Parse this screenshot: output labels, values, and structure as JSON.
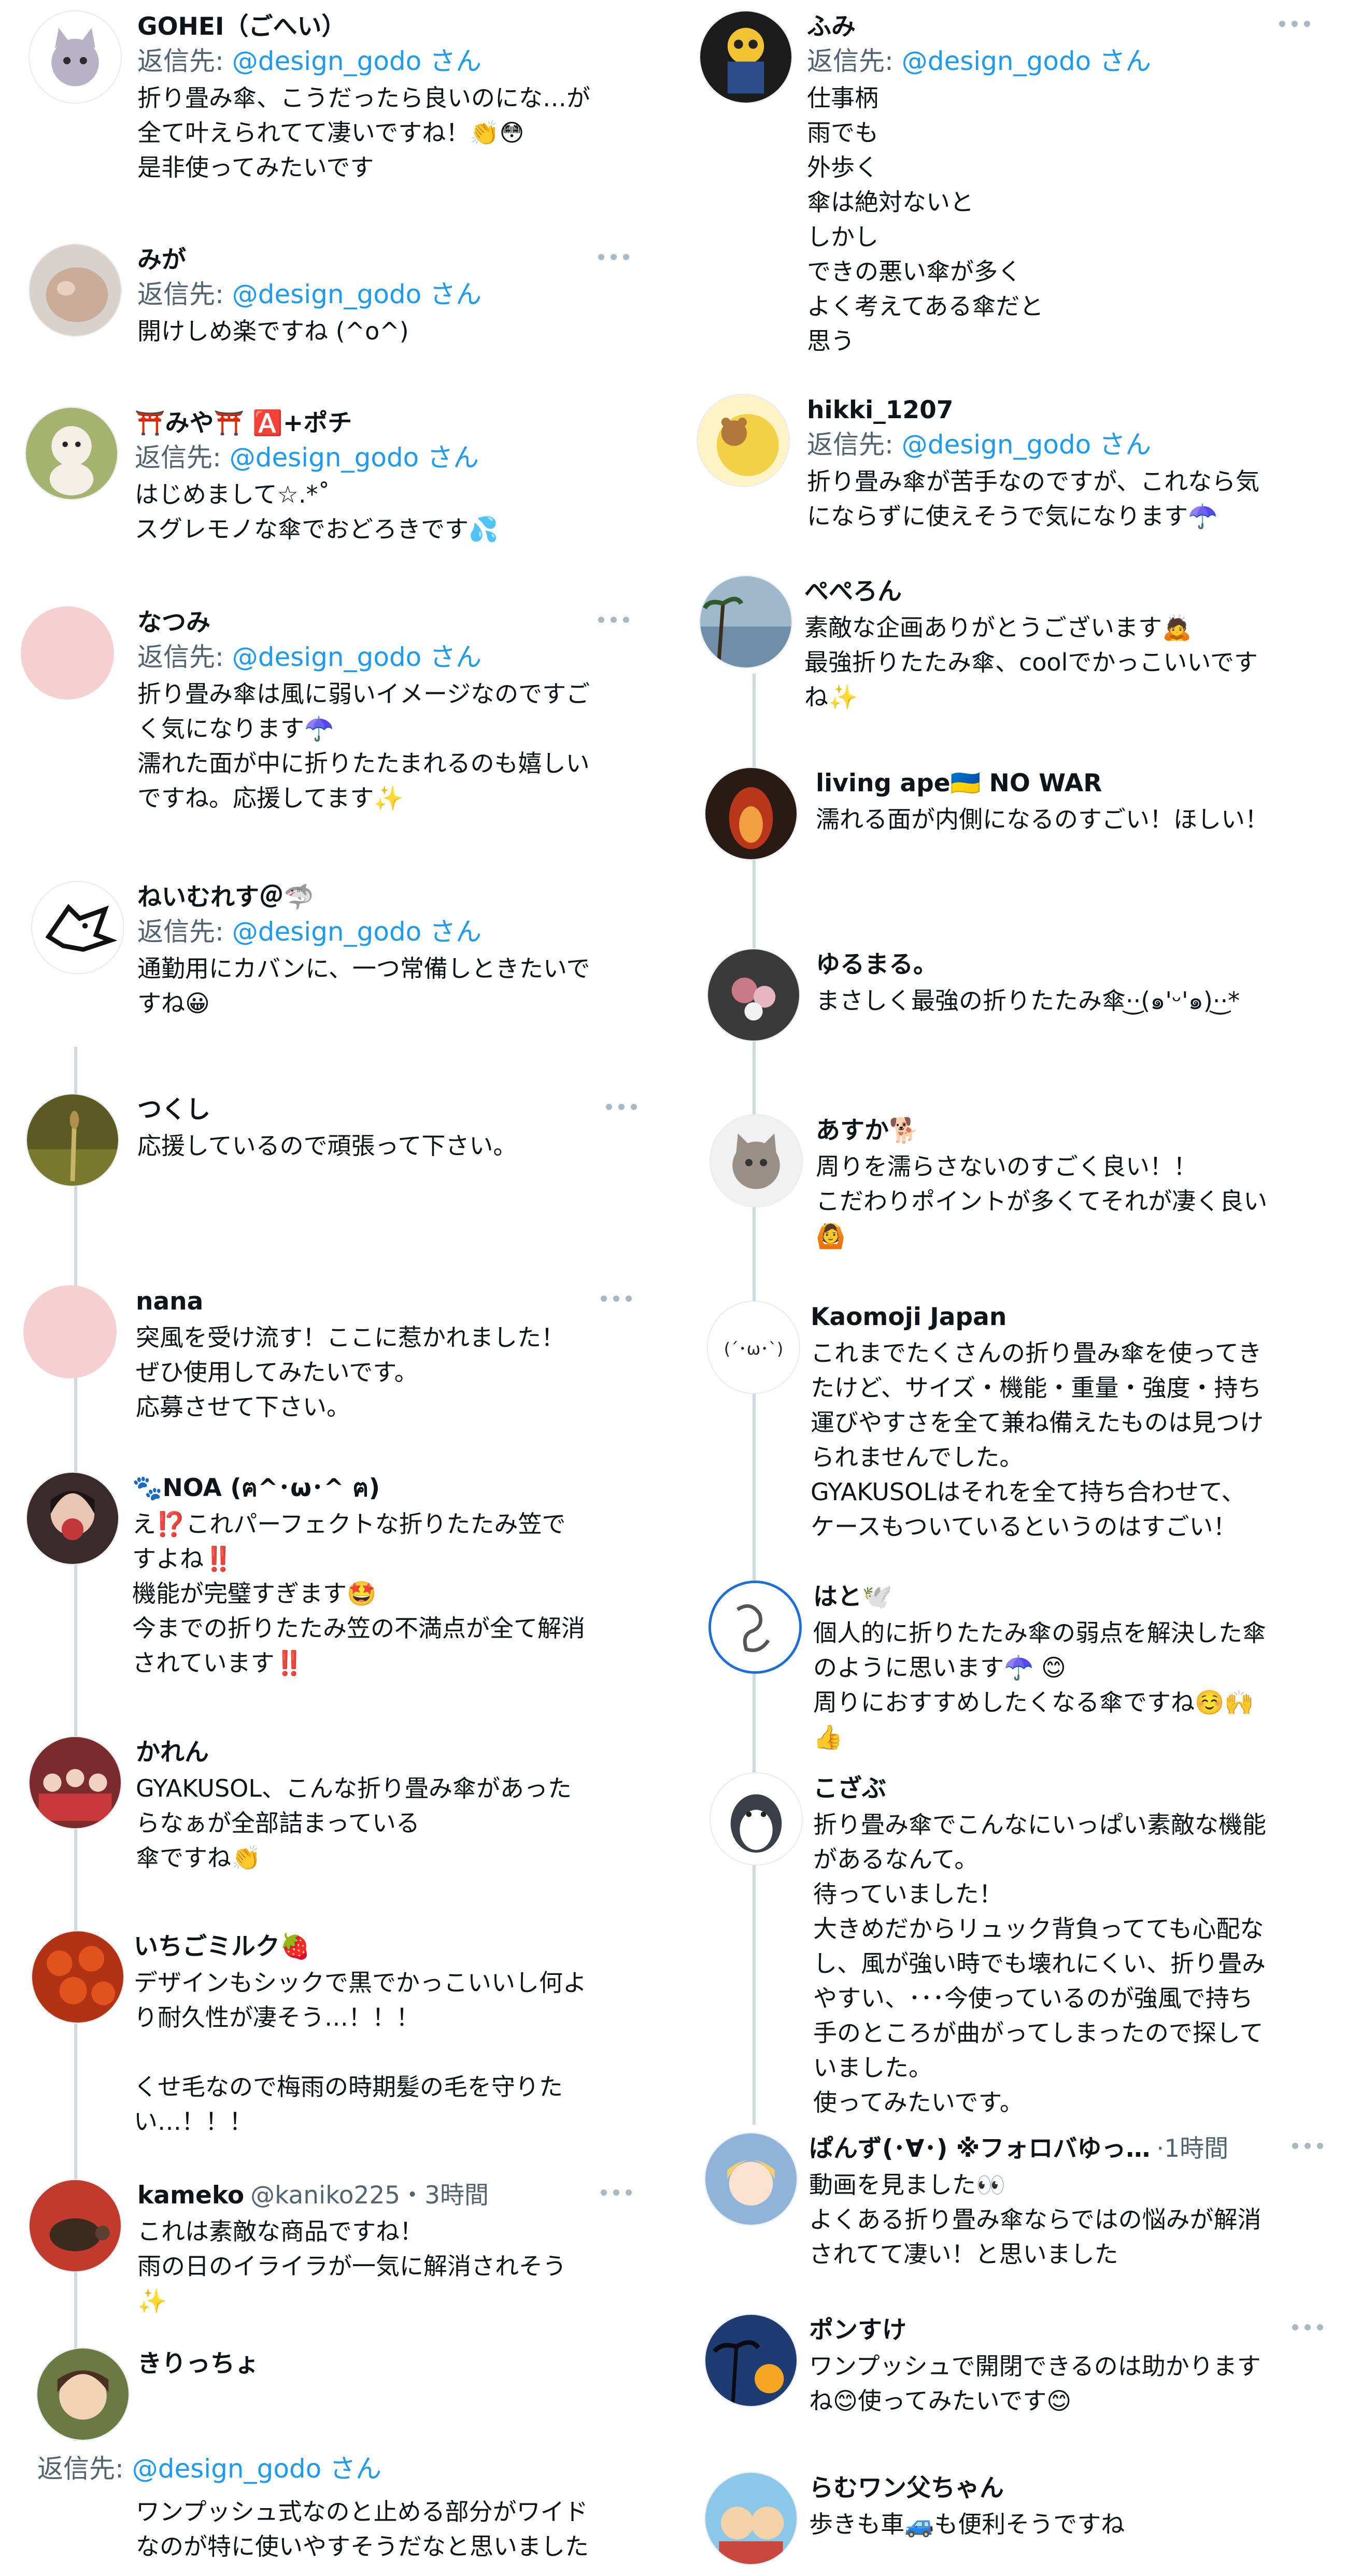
{
  "replyto_prefix": "返信先: ",
  "replyto_suffix": " さん",
  "left": [
    {
      "name": "GOHEI（ごへい）",
      "mention": "@design_godo",
      "text": "折り畳み傘、こうだったら良いのにな…が\n全て叶えられてて凄いですね！👏😳\n是非使ってみたいです",
      "avatar": "cat-illustration",
      "accent": "#b8b2c6"
    },
    {
      "name": "みが",
      "mention": "@design_godo",
      "text": "開けしめ楽ですね (^o^)",
      "avatar": "cat-photo",
      "accent": "#c9ad99"
    },
    {
      "name": "⛩️みや⛩️ 🅰️+ポチ",
      "mention": "@design_godo",
      "text": "はじめまして☆.*˚\nスグレモノな傘でおどろきです💦",
      "avatar": "plush-toy",
      "accent": "#a6b36e"
    },
    {
      "name": "なつみ",
      "mention": "@design_godo",
      "text": "折り畳み傘は風に弱いイメージなのですご\nく気になります☂️\n濡れた面が中に折りたたまれるのも嬉しい\nですね。応援してます✨",
      "avatar": "pink-circle",
      "accent": "#f5cfd2"
    },
    {
      "name": "ねいむれす＠🦈",
      "mention": "@design_godo",
      "text": "通勤用にカバンに、一つ常備しときたいで\nすね😀",
      "avatar": "wolf-drawing",
      "accent": "#ffffff"
    },
    {
      "name": "つくし",
      "text": "応援しているので頑張って下さい。",
      "avatar": "grass-photo",
      "accent": "#7a7a2e"
    },
    {
      "name": "nana",
      "text": "突風を受け流す！ここに惹かれました！\nぜひ使用してみたいです。\n応募させて下さい。",
      "avatar": "pink-circle",
      "accent": "#f5cfd2"
    },
    {
      "name": "🐾NOA (ฅ^･ω･^ ฅ)",
      "text": "え⁉️これパーフェクトな折りたたみ笠で\nすよね‼️\n機能が完璧すぎます🤩\n今までの折りたたみ笠の不満点が全て解消\nされています‼️",
      "avatar": "person-photo",
      "accent": "#c2373a"
    },
    {
      "name": "かれん",
      "text": "GYAKUSOL、こんな折り畳み傘があった\nらなぁが全部詰まっている\n傘ですね👏",
      "avatar": "group-photo",
      "accent": "#c9383a"
    },
    {
      "name": "いちごミルク🍓",
      "text": "デザインもシックで黒でかっこいいし何よ\nり耐久性が凄そう…！！！\n\nくせ毛なので梅雨の時期髪の毛を守りた\nい…！！！",
      "avatar": "strawberries",
      "accent": "#d9481e"
    },
    {
      "name": "kameko",
      "handle": "@kaniko225・3時間",
      "text": "これは素敵な商品ですね！\n雨の日のイライラが一気に解消されそう\n✨",
      "avatar": "turtle-photo",
      "accent": "#8a3b2a"
    },
    {
      "name": "きりっちょ",
      "mention": "@design_godo",
      "text": "ワンプッシュ式なのと止める部分がワイド\nなのが特に使いやすそうだなと思いました",
      "avatar": "anime-character",
      "accent": "#6b7a42"
    }
  ],
  "right": [
    {
      "name": "ふみ",
      "mention": "@design_godo",
      "text": "仕事柄\n雨でも\n外歩く\n傘は絶対ないと\nしかし\nできの悪い傘が多く\nよく考えてある傘だと\n思う",
      "avatar": "robot-figure",
      "accent": "#2e4b8a"
    },
    {
      "name": "hikki_1207",
      "mention": "@design_godo",
      "text": "折り畳み傘が苦手なのですが、これなら気\nにならずに使えそうで気になります☂️",
      "avatar": "bear-on-moon",
      "accent": "#f3d146"
    },
    {
      "name": "ぺぺろん",
      "text": "素敵な企画ありがとうございます🙇\n最強折りたたみ傘、coolでかっこいいです\nね✨",
      "avatar": "beach-photo",
      "accent": "#6f8fa8"
    },
    {
      "name": "living ape🇺🇦 NO WAR",
      "text": "濡れる面が内側になるのすごい！ほしい！",
      "avatar": "fire-photo",
      "accent": "#b8361a"
    },
    {
      "name": "ゆるまる。",
      "text": "まさしく最強の折りたたみ傘·͜·(๑'ᵕ'๑)·͜·*",
      "avatar": "flowers-photo",
      "accent": "#c87a8a"
    },
    {
      "name": "あすか🐕",
      "text": "周りを濡らさないのすごく良い！！\nこだわりポイントが多くてそれが凄く良い\n🙆",
      "avatar": "kitten-photo",
      "accent": "#9a8f86"
    },
    {
      "name": "Kaomoji Japan",
      "text": "これまでたくさんの折り畳み傘を使ってき\nたけど、サイズ・機能・重量・強度・持ち\n運びやすさを全て兼ね備えたものは見つけ\nられませんでした。\nGYAKUSOLはそれを全て持ち合わせて、\nケースもついているというのはすごい！",
      "avatar": "kaomoji-logo",
      "accent": "#ffffff"
    },
    {
      "name": "はと🕊️",
      "text": "個人的に折りたたみ傘の弱点を解決した傘\nのように思います☂️ 😊\n周りにおすすめしたくなる傘ですね☺️🙌\n👍",
      "avatar": "sketch-drawing",
      "accent": "#1d6fd8"
    },
    {
      "name": "こざぶ",
      "text": "折り畳み傘でこんなにいっぱい素敵な機能\nがあるなんて。\n待っていました！\n大きめだからリュック背負ってても心配な\nし、風が強い時でも壊れにくい、折り畳み\nやすい、･･･今使っているのが強風で持ち\n手のところが曲がってしまったので探して\nいました。\n使ってみたいです。",
      "avatar": "penguin-illustration",
      "accent": "#3a3f48"
    },
    {
      "name": "ぱんず(･∀･) ※フォロバゆっ…",
      "handle": "·1時間",
      "text": "動画を見ました👀\nよくある折り畳み傘ならではの悩みが解消\nされてて凄い！と思いました",
      "avatar": "anime-girl",
      "accent": "#8fb3d9"
    },
    {
      "name": "ポンすけ",
      "text": "ワンプッシュで開閉できるのは助かります\nね😊使ってみたいです😊",
      "avatar": "palm-sunset",
      "accent": "#1e3c72"
    },
    {
      "name": "らむワン父ちゃん",
      "text": "歩きも車🚙も便利そうですね",
      "avatar": "cartoon-duo",
      "accent": "#c9473b"
    }
  ]
}
